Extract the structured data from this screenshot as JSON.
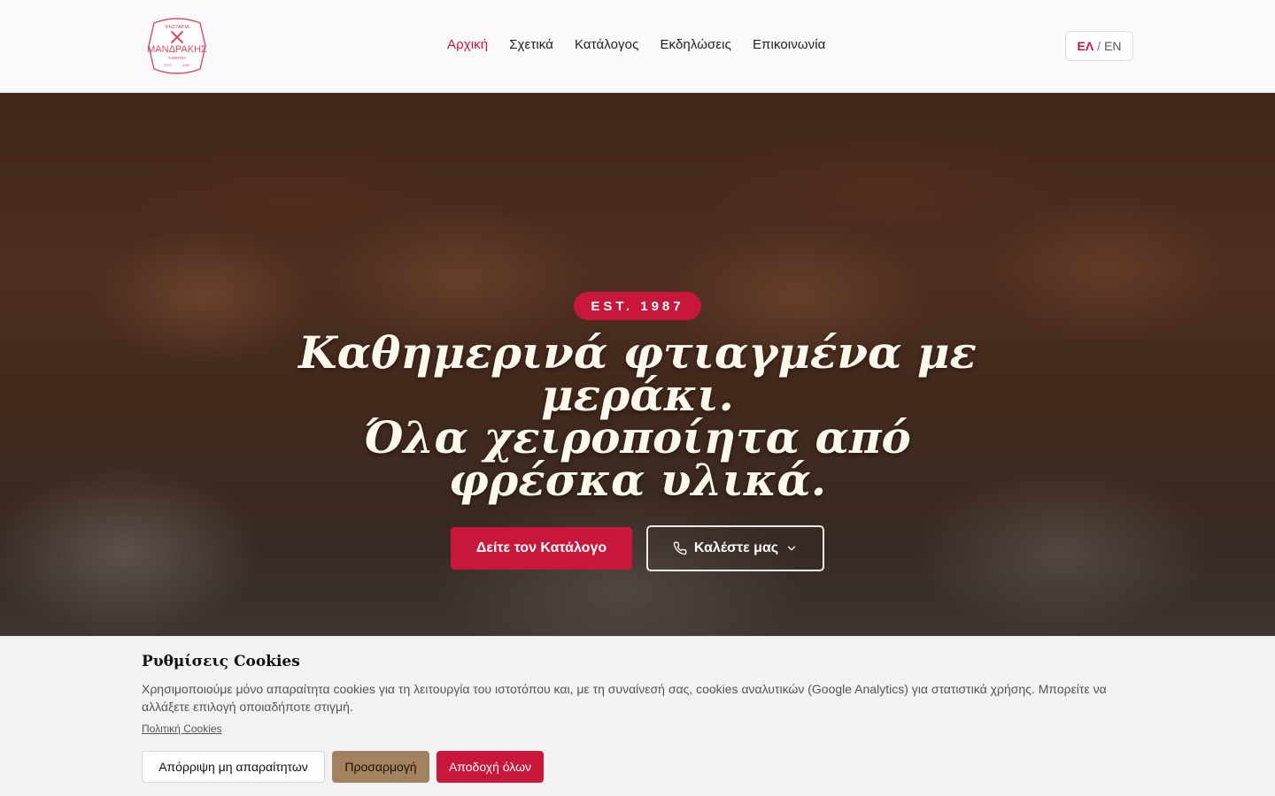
{
  "header": {
    "logo": {
      "top_text": "ΨΗΣΤΑΡΙΑ",
      "name": "ΜΑΝΔΡΑΚΗΣ",
      "sub_text": "ΤΑΒΕΡΝΑ",
      "est_left": "EST.",
      "est_right": "1987",
      "icon": "crossed-fork-knife-icon"
    },
    "nav": [
      {
        "label": "Αρχική",
        "active": true
      },
      {
        "label": "Σχετικά",
        "active": false
      },
      {
        "label": "Κατάλογος",
        "active": false
      },
      {
        "label": "Εκδηλώσεις",
        "active": false
      },
      {
        "label": "Επικοινωνία",
        "active": false
      }
    ],
    "lang": {
      "el": "ΕΛ",
      "separator": "/",
      "en": "EN"
    }
  },
  "hero": {
    "badge": "EST. 1987",
    "headline_line1": "Καθημερινά φτιαγμένα με μεράκι.",
    "headline_line2": "Όλα χειροποίητα από φρέσκα υλικά.",
    "primary_button": "Δείτε τον Κατάλογο",
    "secondary_button": "Καλέστε μας",
    "secondary_icon": "phone-icon",
    "secondary_chevron": "chevron-down-icon"
  },
  "cookie_banner": {
    "title": "Ρυθμίσεις Cookies",
    "text": "Χρησιμοποιούμε μόνο απαραίτητα cookies για τη λειτουργία του ιστοτόπου και, με τη συναίνεσή σας, cookies αναλυτικών (Google Analytics) για στατιστικά χρήσης. Μπορείτε να αλλάξετε επιλογή οποιαδήποτε στιγμή.",
    "policy_link": "Πολιτική Cookies",
    "reject_button": "Απόρριψη μη απαραίτητων",
    "customize_button": "Προσαρμογή",
    "accept_button": "Αποδοχή όλων"
  },
  "colors": {
    "accent": "#c8173a",
    "customize": "#a4825f",
    "headline": "#fff8ec"
  }
}
